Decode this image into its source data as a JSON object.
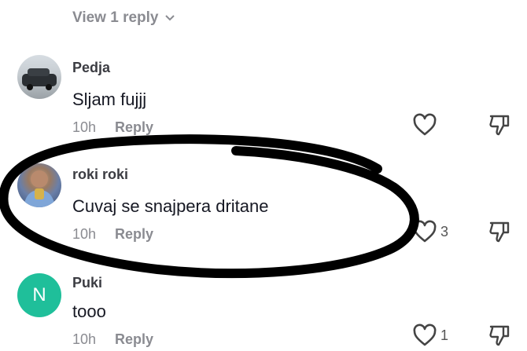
{
  "view_replies": {
    "label": "View 1 reply"
  },
  "comments": [
    {
      "username": "Pedja",
      "text": "Sljam fujjj",
      "time": "10h",
      "reply_label": "Reply",
      "likes": ""
    },
    {
      "username": "roki roki",
      "text": "Cuvaj se snajpera dritane",
      "time": "10h",
      "reply_label": "Reply",
      "likes": "3"
    },
    {
      "username": "Puki",
      "avatar_letter": "N",
      "text": "tooo",
      "time": "10h",
      "reply_label": "Reply",
      "likes": "1"
    }
  ],
  "colors": {
    "avatar_n": "#1fbf9a",
    "annotation": "#000000",
    "muted": "#8a8b91"
  }
}
